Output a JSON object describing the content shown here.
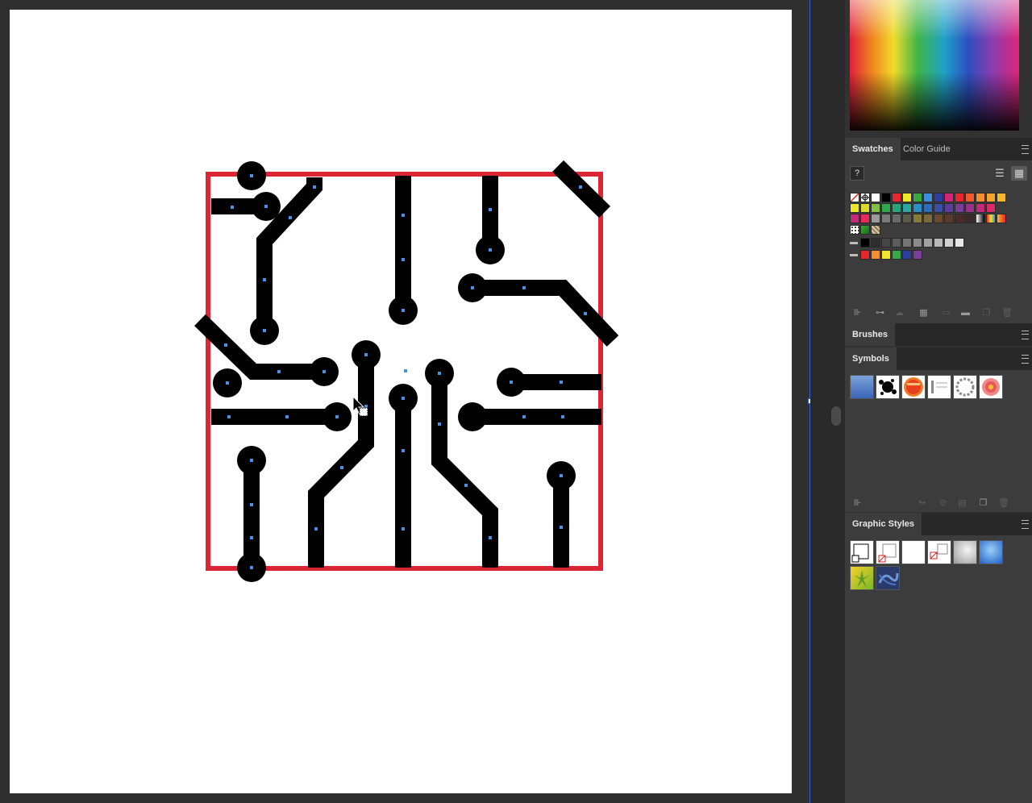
{
  "panels": {
    "swatches": {
      "tab_active": "Swatches",
      "tab_other": "Color Guide",
      "rows": [
        [
          "none",
          "registration",
          "#ffffff",
          "#000000",
          "#e8262d",
          "#f0e62a",
          "#37a843",
          "#3f8fd8",
          "#2d3e9c",
          "#d6237a",
          "#e8262d",
          "#ef5a2a",
          "#f58f2b",
          "#f5a52b",
          "#f5b82b"
        ],
        [
          "#f0e62a",
          "#d9dc2c",
          "#7fbf41",
          "#2fa84f",
          "#2aa37a",
          "#2aa8a0",
          "#2a8fc8",
          "#2a6fb8",
          "#3a4fa8",
          "#5a3d9c",
          "#7a3d9a",
          "#9a2f8c",
          "#c42a7a",
          "#d92a6a"
        ],
        [
          "#c42a7a",
          "#e82a5a",
          "#9a9a9a",
          "#7a7a7a",
          "#6a6a6a",
          "#5a5a4a",
          "#8a7a3a",
          "#7a6a3a",
          "#6a4a2a",
          "#5a3a2a",
          "#4a2a2a",
          "#3a2a2a",
          "grad-bw",
          "grad-color",
          "grad-warm"
        ],
        [
          "pattern-dots",
          "pattern-leaf",
          "pattern-grid"
        ],
        [
          "folder",
          "#000000",
          "#2e2e2e",
          "#454545",
          "#5c5c5c",
          "#747474",
          "#8b8b8b",
          "#a2a2a2",
          "#b9b9b9",
          "#d0d0d0",
          "#e7e7e7"
        ],
        [
          "folder",
          "#e8262d",
          "#f58f2b",
          "#f0e62a",
          "#37a843",
          "#2d3e9c",
          "#7a3d9a"
        ]
      ]
    },
    "brushes": {
      "title": "Brushes"
    },
    "symbols": {
      "title": "Symbols",
      "items": [
        "blue-banner-symbol",
        "ink-splat-symbol",
        "orange-button-symbol",
        "callout-text-symbol",
        "ring-frame-symbol",
        "flower-symbol"
      ]
    },
    "graphic_styles": {
      "title": "Graphic Styles",
      "items": [
        "default-style",
        "no-fill-style",
        "white-fill-style",
        "outline-style",
        "gray-gradient-style",
        "blue-glow-style",
        "yellow-burst-style",
        "blue-texture-style"
      ]
    }
  },
  "colors": {
    "selection_blue": "#4a90e2",
    "frame_red": "#dc2635",
    "trace_black": "#000000",
    "panel_bg": "#3c3c3c"
  }
}
